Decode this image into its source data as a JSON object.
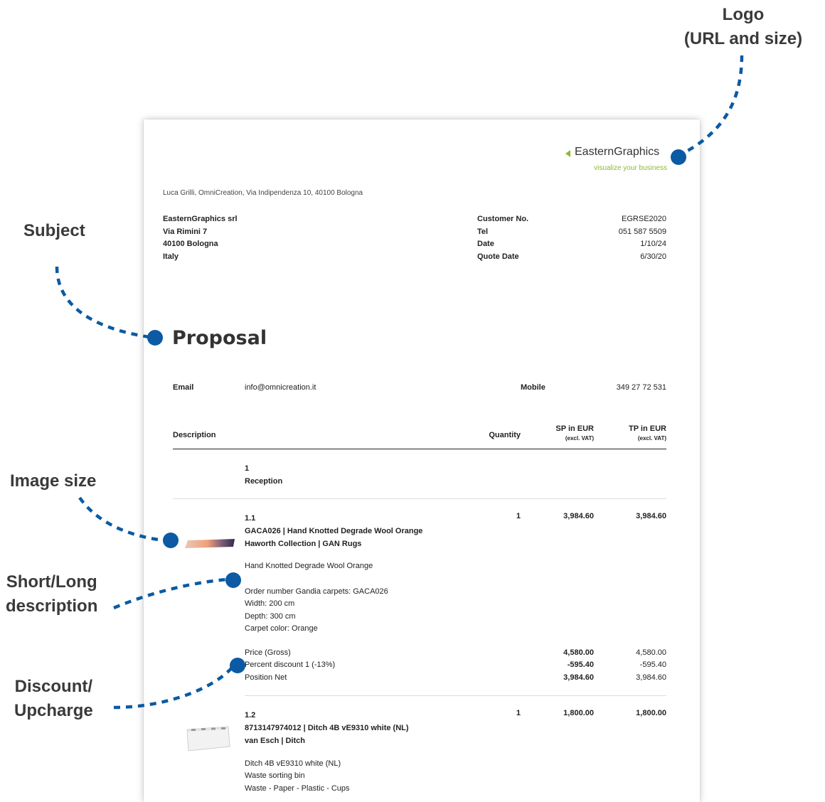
{
  "callouts": {
    "logo_line1": "Logo",
    "logo_line2": "(URL and size)",
    "subject": "Subject",
    "image_size": "Image size",
    "short_long_line1": "Short/Long",
    "short_long_line2": "description",
    "discount_line1": "Discount/",
    "discount_line2": "Upcharge"
  },
  "logo": {
    "name": "EasternGraphics",
    "tagline": "visualize your business",
    "colors": {
      "text": "#333333",
      "accent": "#8dbb2e"
    }
  },
  "sender_line": "Luca Grilli, OmniCreation, Via Indipendenza 10, 40100 Bologna",
  "recipient": [
    "EasternGraphics srl",
    "Via Rimini 7",
    "40100 Bologna",
    "Italy"
  ],
  "meta": [
    {
      "label": "Customer No.",
      "value": "EGRSE2020"
    },
    {
      "label": "Tel",
      "value": "051 587 5509"
    },
    {
      "label": "Date",
      "value": "1/10/24"
    },
    {
      "label": "Quote Date",
      "value": "6/30/20"
    }
  ],
  "subject": "Proposal",
  "contact": {
    "email_label": "Email",
    "email_value": "info@omnicreation.it",
    "mobile_label": "Mobile",
    "mobile_value": "349 27 72 531"
  },
  "table_header": {
    "description": "Description",
    "quantity": "Quantity",
    "sp": "SP in EUR",
    "sp_sub": "(excl. VAT)",
    "tp": "TP in EUR",
    "tp_sub": "(excl. VAT)"
  },
  "section": {
    "number": "1",
    "title": "Reception"
  },
  "item1": {
    "pos": "1.1",
    "title1": "GACA026 | Hand Knotted Degrade Wool Orange",
    "title2": "Haworth Collection | GAN Rugs",
    "qty": "1",
    "sp": "3,984.60",
    "tp": "3,984.60",
    "short_desc": "Hand Knotted Degrade Wool Orange",
    "long_desc": [
      "Order number Gandia carpets: GACA026",
      "Width: 200 cm",
      "Depth: 300 cm",
      "Carpet color: Orange"
    ],
    "price_lines": [
      {
        "label": "Price (Gross)",
        "sp": "4,580.00",
        "tp": "4,580.00"
      },
      {
        "label": "Percent discount 1 (-13%)",
        "sp": "-595.40",
        "tp": "-595.40"
      },
      {
        "label": "Position Net",
        "sp": "3,984.60",
        "tp": "3,984.60"
      }
    ]
  },
  "item2": {
    "pos": "1.2",
    "title1": "8713147974012 | Ditch 4B vE9310 white (NL)",
    "title2": "van Esch | Ditch",
    "qty": "1",
    "sp": "1,800.00",
    "tp": "1,800.00",
    "desc": [
      "Ditch 4B vE9310 white (NL)",
      "Waste sorting bin",
      "Waste - Paper - Plastic - Cups"
    ]
  },
  "colors": {
    "callout_dot": "#0b5aa3",
    "callout_text": "#3a3a3a"
  }
}
